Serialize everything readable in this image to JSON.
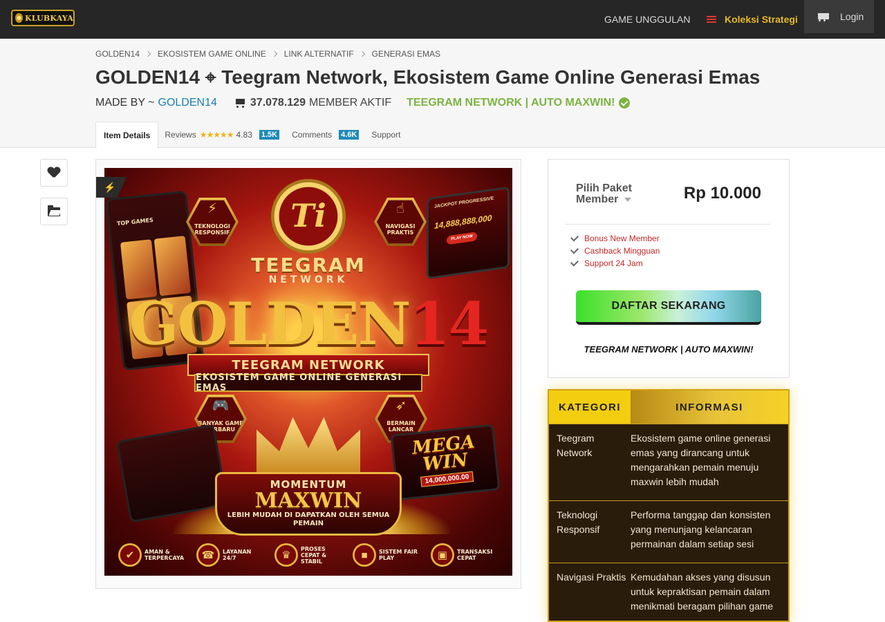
{
  "nav": {
    "logo_text": "KLUBKAYA",
    "game_unggulan": "GAME UNGGULAN",
    "koleksi_strategi": "Koleksi Strategi",
    "login": "Login"
  },
  "breadcrumb": [
    "GOLDEN14",
    "EKOSISTEM GAME ONLINE",
    "LINK ALTERNATIF",
    "GENERASI EMAS"
  ],
  "page": {
    "title": "GOLDEN14 ⌖ Teegram Network, Ekosistem Game Online Generasi Emas",
    "made_by_label": "MADE BY ~",
    "author": "GOLDEN14",
    "member_count": "37.078.129",
    "member_label": "MEMBER AKTIF",
    "promo": "TEEGRAM NETWORK | AUTO MAXWIN!"
  },
  "tabs": {
    "item_details": "Item Details",
    "reviews": "Reviews",
    "stars": "★★★★★",
    "rating": "4.83",
    "reviews_count": "1.5K",
    "comments": "Comments",
    "comments_count": "4.6K",
    "support": "Support"
  },
  "banner": {
    "logo_letter": "Ti",
    "teegram": "TEEGRAM",
    "network": "NETWORK",
    "golden": "GOLDEN",
    "golden_num": "14",
    "ribbon1": "TEEGRAM NETWORK",
    "ribbon2": "EKOSISTEM GAME ONLINE GENERASI EMAS",
    "hex1": "TEKNOLOGI RESPONSIF",
    "hex2": "NAVIGASI PRAKTIS",
    "hex3": "BANYAK GAME TERBARU",
    "hex4": "BERMAIN LANCAR",
    "phone_top": "TOP GAMES",
    "jackpot_title": "JACKPOT PROGRESSIVE",
    "jackpot_value": "14,888,888,000",
    "jackpot_btn": "PLAY NOW",
    "momentum": "MOMENTUM",
    "maxwin": "MAXWIN",
    "maxwin_sub": "LEBIH MUDAH DI DAPATKAN OLEH SEMUA PEMAIN",
    "mega": "MEGA WIN",
    "mega_value": "14,000,000.00",
    "footer": [
      "AMAN & TERPERCAYA",
      "LAYANAN 24/7",
      "PROSES CEPAT & STABIL",
      "SISTEM FAIR PLAY",
      "TRANSAKSI CEPAT"
    ]
  },
  "buy": {
    "package_label": "Pilih Paket Member",
    "price": "Rp 10.000",
    "features": [
      "Bonus New Member",
      "Cashback Mingguan",
      "Support 24 Jam"
    ],
    "cta": "DAFTAR SEKARANG",
    "tagline": "TEEGRAM NETWORK | AUTO MAXWIN!"
  },
  "info": {
    "head_kategori": "KATEGORI",
    "head_informasi": "INFORMASI",
    "rows": [
      {
        "k": "Teegram Network",
        "v": "Ekosistem game online generasi emas yang dirancang untuk mengarahkan pemain menuju maxwin lebih mudah"
      },
      {
        "k": "Teknologi Responsif",
        "v": "Performa tanggap dan konsisten yang menunjang kelancaran permainan dalam setiap sesi"
      },
      {
        "k": "Navigasi Praktis",
        "v": "Kemudahan akses yang disusun untuk kepraktisan pemain dalam menikmati beragam pilihan game"
      }
    ]
  },
  "colors": {
    "topbar": "#262626",
    "accent_gold": "#e8b923",
    "promo_green": "#7cb342",
    "link_blue": "#1a7fb0",
    "feature_red": "#c62828"
  }
}
